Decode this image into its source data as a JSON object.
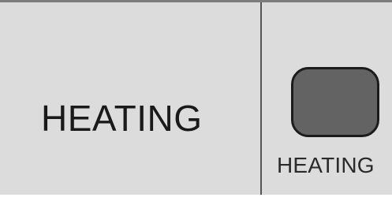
{
  "heating_panel": {
    "mode_label": "HEATING",
    "indicator": {
      "caption": "HEATING",
      "state": "off",
      "fill_color": "#636363",
      "border_color": "#1c1c1c"
    }
  },
  "colors": {
    "panel_background": "#dcdcdc",
    "divider": "#555555",
    "top_border": "#7c7c7c"
  }
}
